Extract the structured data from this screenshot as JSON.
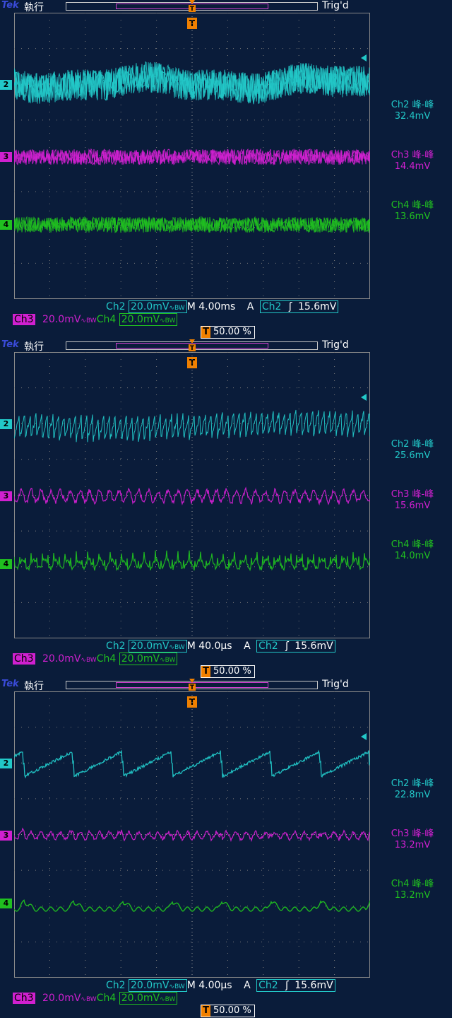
{
  "screens": [
    {
      "brand": "Tek",
      "run_state": "執行",
      "trig_status": "Trig'd",
      "trigger_marker": "T",
      "channels": [
        {
          "gnd": "2",
          "name": "Ch2 峰-峰",
          "value": "32.4mV"
        },
        {
          "gnd": "3",
          "name": "Ch3 峰-峰",
          "value": "14.4mV"
        },
        {
          "gnd": "4",
          "name": "Ch4 峰-峰",
          "value": "13.6mV"
        }
      ],
      "status": {
        "ch2_label": "Ch2",
        "ch2_scale": "20.0mV",
        "ch3_label": "Ch3",
        "ch3_scale": "20.0mV",
        "ch4_label": "Ch4",
        "ch4_scale": "20.0mV",
        "bw_glyph": "∿BW",
        "timebase": "M 4.00ms",
        "trig_mode": "A",
        "trig_source": "Ch2",
        "trig_slope": "ʃ",
        "trig_level": "15.6mV",
        "trig_position": "50.00 %"
      }
    },
    {
      "brand": "Tek",
      "run_state": "執行",
      "trig_status": "Trig'd",
      "trigger_marker": "T",
      "channels": [
        {
          "gnd": "2",
          "name": "Ch2 峰-峰",
          "value": "25.6mV"
        },
        {
          "gnd": "3",
          "name": "Ch3 峰-峰",
          "value": "15.6mV"
        },
        {
          "gnd": "4",
          "name": "Ch4 峰-峰",
          "value": "14.0mV"
        }
      ],
      "status": {
        "ch2_label": "Ch2",
        "ch2_scale": "20.0mV",
        "ch3_label": "Ch3",
        "ch3_scale": "20.0mV",
        "ch4_label": "Ch4",
        "ch4_scale": "20.0mV",
        "bw_glyph": "∿BW",
        "timebase": "M 40.0µs",
        "trig_mode": "A",
        "trig_source": "Ch2",
        "trig_slope": "ʃ",
        "trig_level": "15.6mV",
        "trig_position": "50.00 %"
      }
    },
    {
      "brand": "Tek",
      "run_state": "執行",
      "trig_status": "Trig'd",
      "trigger_marker": "T",
      "channels": [
        {
          "gnd": "2",
          "name": "Ch2 峰-峰",
          "value": "22.8mV"
        },
        {
          "gnd": "3",
          "name": "Ch3 峰-峰",
          "value": "13.2mV"
        },
        {
          "gnd": "4",
          "name": "Ch4 峰-峰",
          "value": "13.2mV"
        }
      ],
      "status": {
        "ch2_label": "Ch2",
        "ch2_scale": "20.0mV",
        "ch3_label": "Ch3",
        "ch3_scale": "20.0mV",
        "ch4_label": "Ch4",
        "ch4_scale": "20.0mV",
        "bw_glyph": "∿BW",
        "timebase": "M 4.00µs",
        "trig_mode": "A",
        "trig_source": "Ch2",
        "trig_slope": "ʃ",
        "trig_level": "15.6mV",
        "trig_position": "50.00 %"
      }
    }
  ],
  "colors": {
    "background": "#0a1c3a",
    "ch2": "#22c8c8",
    "ch3": "#d020d0",
    "ch4": "#20c020",
    "trigger": "#f08000",
    "grid": "#8a8a8a"
  }
}
